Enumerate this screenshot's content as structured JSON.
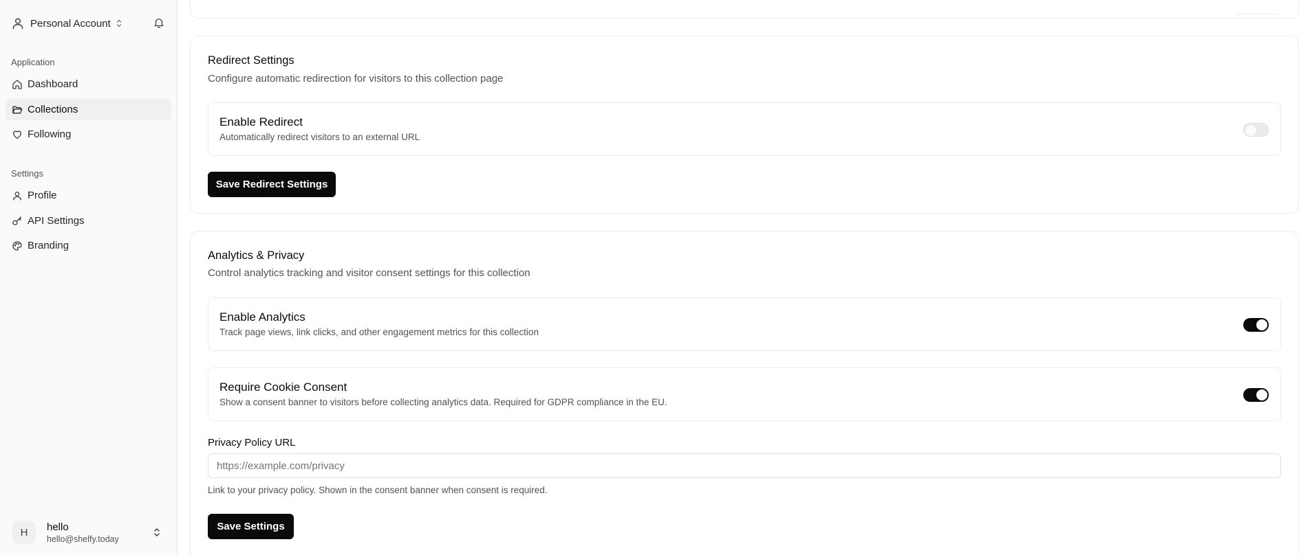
{
  "sidebar": {
    "account_label": "Personal Account",
    "groups": {
      "application": {
        "label": "Application",
        "items": [
          {
            "label": "Dashboard",
            "icon": "home-icon"
          },
          {
            "label": "Collections",
            "icon": "folder-open-icon",
            "active": true
          },
          {
            "label": "Following",
            "icon": "heart-icon"
          }
        ]
      },
      "settings": {
        "label": "Settings",
        "items": [
          {
            "label": "Profile",
            "icon": "user-icon"
          },
          {
            "label": "API Settings",
            "icon": "key-icon"
          },
          {
            "label": "Branding",
            "icon": "palette-icon"
          }
        ]
      }
    },
    "user": {
      "initial": "H",
      "name": "hello",
      "email": "hello@shelfy.today"
    }
  },
  "redirect": {
    "title": "Redirect Settings",
    "description": "Configure automatic redirection for visitors to this collection page",
    "enable_redirect": {
      "title": "Enable Redirect",
      "description": "Automatically redirect visitors to an external URL",
      "enabled": false
    },
    "save_label": "Save Redirect Settings"
  },
  "analytics": {
    "title": "Analytics & Privacy",
    "description": "Control analytics tracking and visitor consent settings for this collection",
    "enable_analytics": {
      "title": "Enable Analytics",
      "description": "Track page views, link clicks, and other engagement metrics for this collection",
      "enabled": true
    },
    "cookie_consent": {
      "title": "Require Cookie Consent",
      "description": "Show a consent banner to visitors before collecting analytics data. Required for GDPR compliance in the EU.",
      "enabled": true
    },
    "privacy_policy": {
      "label": "Privacy Policy URL",
      "value": "",
      "placeholder": "https://example.com/privacy",
      "help": "Link to your privacy policy. Shown in the consent banner when consent is required."
    },
    "save_label": "Save Settings"
  }
}
